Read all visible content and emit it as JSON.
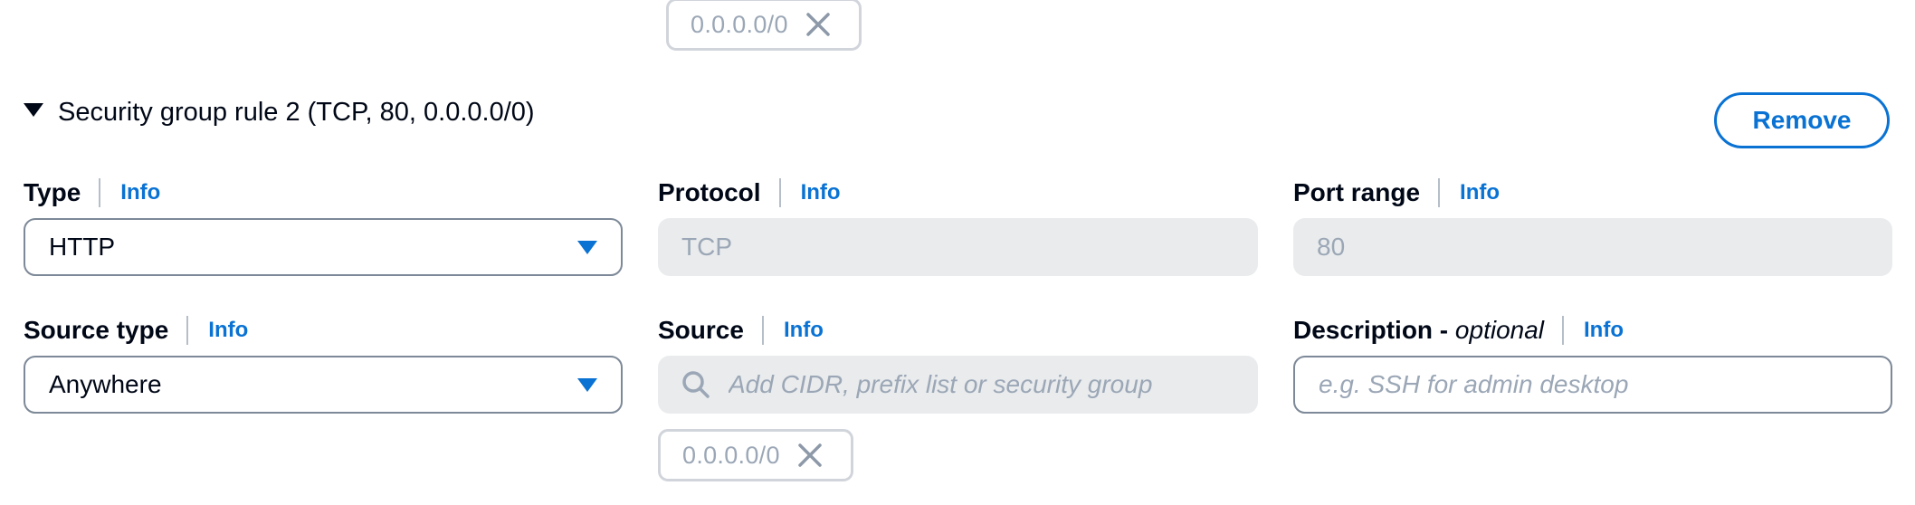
{
  "top_token": {
    "value": "0.0.0.0/0",
    "remove_icon": "close-icon"
  },
  "rule": {
    "title": "Security group rule 2 (TCP, 80, 0.0.0.0/0)",
    "remove_label": "Remove"
  },
  "fields": {
    "type": {
      "label": "Type",
      "info": "Info",
      "value": "HTTP"
    },
    "protocol": {
      "label": "Protocol",
      "info": "Info",
      "value": "TCP"
    },
    "port_range": {
      "label": "Port range",
      "info": "Info",
      "value": "80"
    },
    "source_type": {
      "label": "Source type",
      "info": "Info",
      "value": "Anywhere"
    },
    "source": {
      "label": "Source",
      "info": "Info",
      "placeholder": "Add CIDR, prefix list or security group",
      "token": "0.0.0.0/0"
    },
    "description": {
      "label": "Description - ",
      "label_optional": "optional",
      "info": "Info",
      "placeholder": "e.g. SSH for admin desktop"
    }
  },
  "colors": {
    "link": "#0972d3",
    "text": "#000716",
    "muted": "#9ba7b6",
    "disabled_bg": "#e9ebed",
    "border": "#7d8998"
  }
}
